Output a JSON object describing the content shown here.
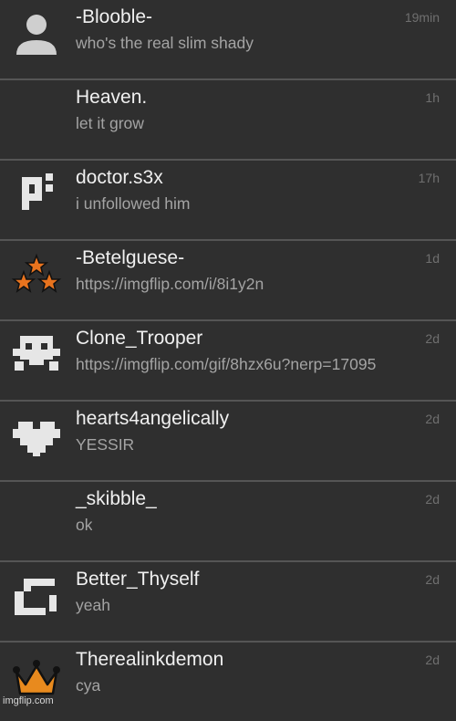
{
  "conversations": [
    {
      "name": "-Blooble-",
      "message": "who's the real slim shady",
      "time": "19min",
      "avatar": "default-user-icon"
    },
    {
      "name": "Heaven.",
      "message": "let it grow",
      "time": "1h",
      "avatar": ""
    },
    {
      "name": "doctor.s3x",
      "message": "i unfollowed him",
      "time": "17h",
      "avatar": "pixel-p-icon"
    },
    {
      "name": "-Betelguese-",
      "message": "https://imgflip.com/i/8i1y2n",
      "time": "1d",
      "avatar": "three-stars-icon"
    },
    {
      "name": "Clone_Trooper",
      "message": "https://imgflip.com/gif/8hzx6u?nerp=17095",
      "time": "2d",
      "avatar": "pixel-invader-icon"
    },
    {
      "name": "hearts4angelically",
      "message": "YESSIR",
      "time": "2d",
      "avatar": "pixel-heart-icon"
    },
    {
      "name": "_skibble_",
      "message": "ok",
      "time": "2d",
      "avatar": ""
    },
    {
      "name": "Better_Thyself",
      "message": "yeah",
      "time": "2d",
      "avatar": "pixel-bracket-icon"
    },
    {
      "name": "Therealinkdemon",
      "message": "cya",
      "time": "2d",
      "avatar": "crown-icon"
    }
  ],
  "watermark": "imgflip.com",
  "colors": {
    "background": "#2f2f2f",
    "divider": "#555555",
    "name": "#f0f0f0",
    "message": "#a4a4a4",
    "time": "#6f6f6f",
    "star_orange": "#e8731e",
    "crown_orange": "#e88a1e"
  }
}
